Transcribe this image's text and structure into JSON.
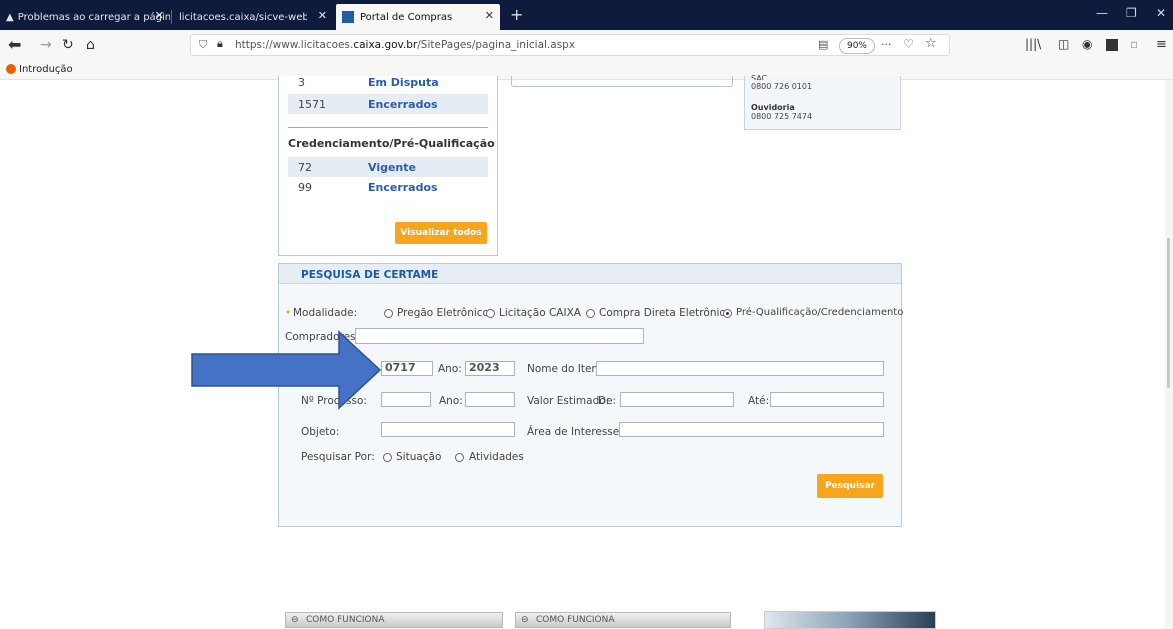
{
  "browser": {
    "tabs": [
      {
        "title": "Problemas ao carregar a página",
        "active": false
      },
      {
        "title": "licitacoes.caixa/sicve-web/private/",
        "active": false
      },
      {
        "title": "Portal de Compras",
        "active": true
      }
    ],
    "url_prefix": "https://www.licitacoes.",
    "url_domain": "caixa.gov.br",
    "url_path": "/SitePages/pagina_inicial.aspx",
    "zoom": "90%",
    "bookmark": "Introdução"
  },
  "stats": {
    "licitacoes": [
      {
        "count": "3",
        "label": "Em Disputa"
      },
      {
        "count": "1571",
        "label": "Encerrados"
      }
    ],
    "credenciamento_title": "Credenciamento/Pré-Qualificação",
    "credenciamento": [
      {
        "count": "72",
        "label": "Vigente"
      },
      {
        "count": "99",
        "label": "Encerrados"
      }
    ],
    "view_all": "Visualizar todos"
  },
  "contact": {
    "sac_label": "SAC",
    "sac_phone": "0800 726 0101",
    "ouvidoria_label": "Ouvidoria",
    "ouvidoria_phone": "0800 725 7474"
  },
  "search": {
    "title": "PESQUISA DE CERTAME",
    "modalidade_label": "Modalidade:",
    "modalidade_options": [
      "Pregão Eletrônico",
      "Licitação CAIXA",
      "Compra Direta Eletrônica",
      "Pré-Qualificação/Credenciamento"
    ],
    "modalidade_selected": 3,
    "compradores_label": "Compradores:",
    "numero_value": "0717",
    "ano_label": "Ano:",
    "ano_value": "2023",
    "nome_item_label": "Nome do Item:",
    "processo_label": "Nº Processo:",
    "valor_estimado_label": "Valor Estimado:",
    "de_label": "De:",
    "ate_label": "Até:",
    "objeto_label": "Objeto:",
    "area_label": "Área de Interesse:",
    "pesquisar_por_label": "Pesquisar Por:",
    "pesquisar_por_options": [
      "Situação",
      "Atividades"
    ],
    "search_button": "Pesquisar"
  },
  "footer": {
    "como_funciona_1": "COMO FUNCIONA",
    "como_funciona_2": "COMO FUNCIONA"
  },
  "colors": {
    "accent_orange": "#f7a51d",
    "link_blue": "#2a5ea8",
    "arrow_blue": "#4472c4",
    "tabbar": "#0f1b3d"
  }
}
